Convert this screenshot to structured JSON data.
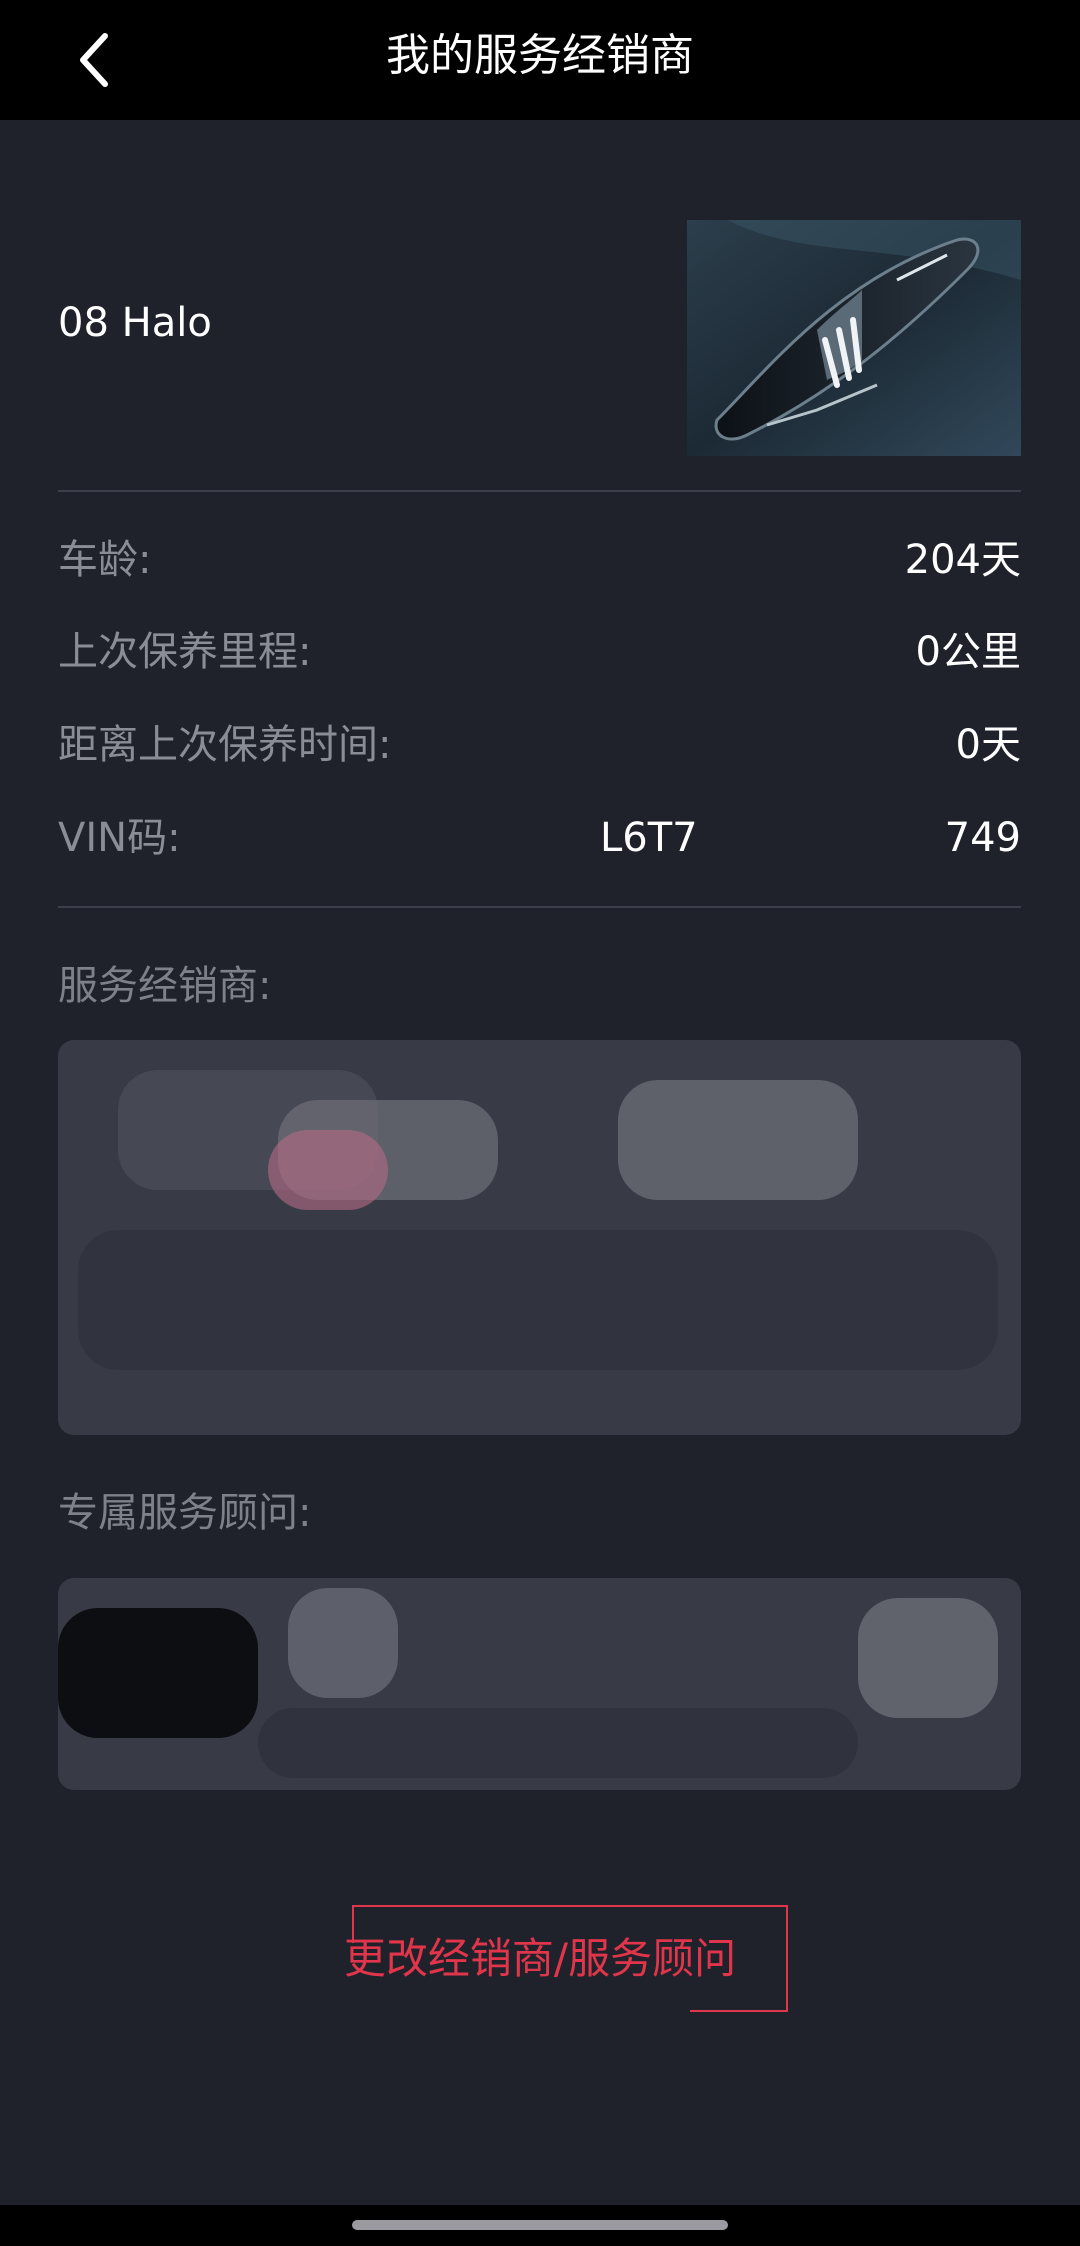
{
  "header": {
    "title": "我的服务经销商",
    "back_icon": "chevron-left-icon"
  },
  "vehicle": {
    "name": "08 Halo",
    "image": "headlight-image"
  },
  "info": {
    "car_age_label": "车龄:",
    "car_age_value": "204天",
    "last_service_mileage_label": "上次保养里程:",
    "last_service_mileage_value": "0公里",
    "since_last_service_label": "距离上次保养时间:",
    "since_last_service_value": "0天",
    "vin_label": "VIN码:",
    "vin_prefix": "L6T7",
    "vin_suffix": "749"
  },
  "dealer": {
    "label": "服务经销商:"
  },
  "advisor": {
    "label": "专属服务顾问:"
  },
  "actions": {
    "change_label": "更改经销商/服务顾问"
  },
  "colors": {
    "background": "#1f222b",
    "topbar": "#000000",
    "card": "#383b46",
    "accent": "#e0354a"
  }
}
